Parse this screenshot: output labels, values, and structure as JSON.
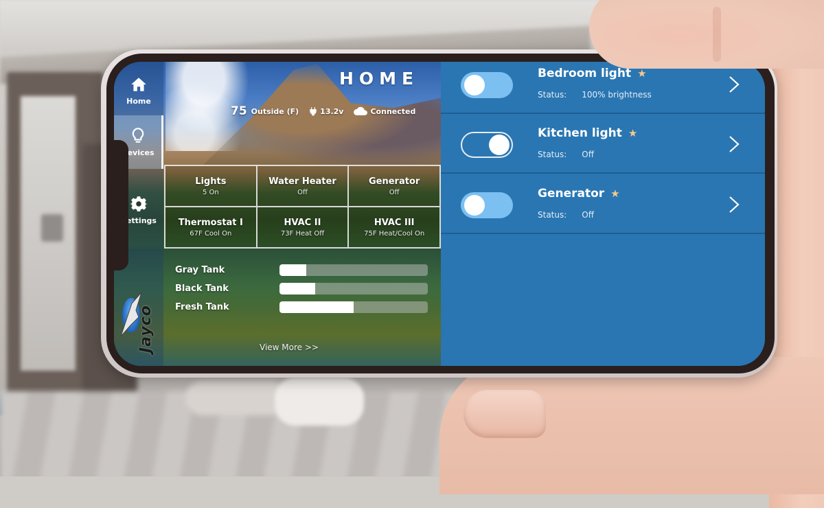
{
  "sidebar": {
    "items": [
      {
        "label": "Home",
        "icon": "home-icon"
      },
      {
        "label": "Devices",
        "icon": "lightbulb-icon",
        "active": true
      },
      {
        "label": "Settings",
        "icon": "gear-icon"
      }
    ],
    "logo_text": "Jayco"
  },
  "hero": {
    "title": "HOME",
    "temperature": "75",
    "temperature_label": "Outside (F)",
    "voltage": "13.2v",
    "connection": "Connected"
  },
  "tiles": [
    {
      "name": "Lights",
      "value": "5 On"
    },
    {
      "name": "Water Heater",
      "value": "Off"
    },
    {
      "name": "Generator",
      "value": "Off"
    },
    {
      "name": "Thermostat I",
      "value": "67F Cool On"
    },
    {
      "name": "HVAC II",
      "value": "73F Heat Off"
    },
    {
      "name": "HVAC III",
      "value": "75F Heat/Cool On"
    }
  ],
  "tanks": [
    {
      "label": "Gray Tank",
      "level_percent": 18
    },
    {
      "label": "Black Tank",
      "level_percent": 24
    },
    {
      "label": "Fresh Tank",
      "level_percent": 50
    }
  ],
  "view_more": "View More >>",
  "devices": [
    {
      "name": "Bedroom light",
      "favorite": true,
      "status_label": "Status:",
      "status": "100% brightness",
      "toggle_style": "filled"
    },
    {
      "name": "Kitchen light",
      "favorite": true,
      "status_label": "Status:",
      "status": "Off",
      "toggle_style": "outline"
    },
    {
      "name": "Generator",
      "favorite": true,
      "status_label": "Status:",
      "status": "Off",
      "toggle_style": "filled"
    }
  ],
  "colors": {
    "device_panel_bg": "#2a76b2",
    "toggle_on": "#7cc0f2",
    "favorite_star": "#f6c98b"
  },
  "star_glyph": "★"
}
